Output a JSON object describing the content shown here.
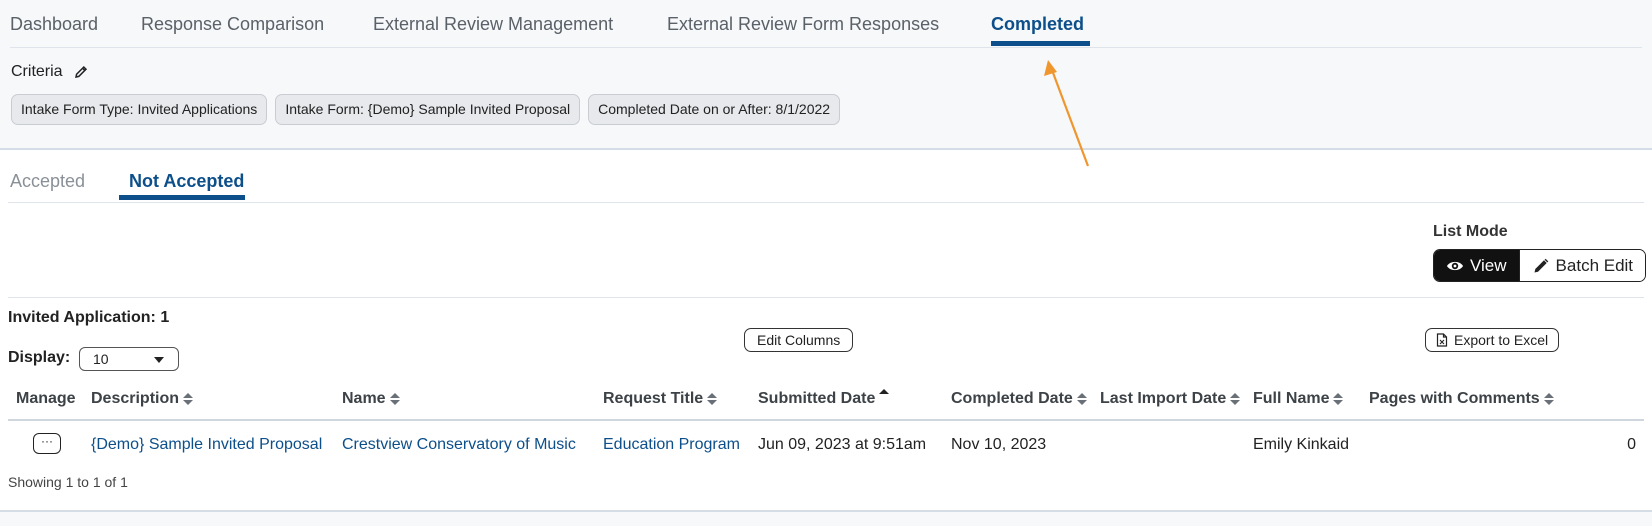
{
  "nav": {
    "tabs": [
      "Dashboard",
      "Response Comparison",
      "External Review Management",
      "External Review Form Responses",
      "Completed"
    ],
    "active": "Completed"
  },
  "criteria": {
    "label": "Criteria",
    "chips": [
      "Intake Form Type: Invited Applications",
      "Intake Form: {Demo} Sample Invited Proposal",
      "Completed Date on or After: 8/1/2022"
    ]
  },
  "subtabs": {
    "accepted": "Accepted",
    "not_accepted": "Not Accepted",
    "active": "Not Accepted"
  },
  "list_mode": {
    "label": "List Mode",
    "view": "View",
    "batch_edit": "Batch Edit",
    "active": "View"
  },
  "summary": {
    "label": "Invited Application:",
    "count": "1"
  },
  "controls": {
    "display_label": "Display:",
    "display_value": "10",
    "edit_columns": "Edit Columns",
    "export": "Export to Excel"
  },
  "table": {
    "columns": [
      "Manage",
      "Description",
      "Name",
      "Request Title",
      "Submitted Date",
      "Completed Date",
      "Last Import Date",
      "Full Name",
      "Pages with Comments"
    ],
    "sorted_column": "Submitted Date",
    "rows": [
      {
        "manage": "···",
        "description": "{Demo} Sample Invited Proposal",
        "name": "Crestview Conservatory of Music",
        "request_title": "Education Program",
        "submitted_date": "Jun 09, 2023 at 9:51am",
        "completed_date": "Nov 10, 2023",
        "last_import_date": "",
        "full_name": "Emily Kinkaid",
        "pages_with_comments": "0"
      }
    ],
    "showing": "Showing 1 to 1 of 1"
  },
  "colors": {
    "accent": "#0c4f8a",
    "annotation_arrow": "#f0962e"
  }
}
